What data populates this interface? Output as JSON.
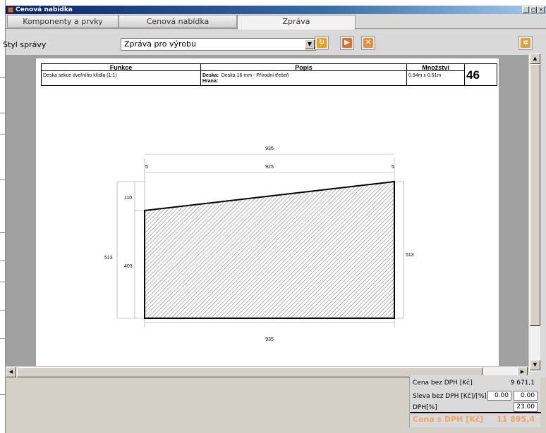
{
  "window": {
    "title": "Cenová nabídka",
    "controls": [
      "_",
      "□",
      "×"
    ]
  },
  "tabs": [
    {
      "label": "Komponenty a prvky",
      "active": false
    },
    {
      "label": "Cenová nabídka",
      "active": false
    },
    {
      "label": "Zpráva",
      "active": true
    }
  ],
  "toolbar": {
    "style_label": "Styl správy",
    "style_value": "Zpráva pro výrobu",
    "buttons": [
      "refresh-icon",
      "export-pdf-icon",
      "export-image-icon",
      "help-icon"
    ]
  },
  "report": {
    "headers": {
      "funkce": "Funkce",
      "popis": "Popis",
      "mnozstvi": "Množství"
    },
    "row": {
      "funkce": "Deska sekce dveřního křídla (1:1)",
      "deska_label": "Deska:",
      "deska_value": "Deska 16 mm - Přírodní třešeň",
      "hrana_label": "Hrana:",
      "mnozstvi": "0.94m x 0.51m",
      "count": "46"
    },
    "dimensions": {
      "top_total": "935",
      "top_left": "5",
      "top_middle": "925",
      "top_right": "5",
      "left_total": "513",
      "left_upper": "110",
      "left_lower": "403",
      "right_total": "513",
      "bottom_total": "935"
    }
  },
  "prices": {
    "cena_bez_dph_label": "Cena bez DPH [Kč]",
    "cena_bez_dph_value": "9 671,1",
    "sleva_label": "Sleva bez DPH [Kč]/[%]",
    "sleva_kc": "0.00",
    "sleva_pct": "0.00",
    "dph_label": "DPH[%]",
    "dph_value": "23.00",
    "cena_s_dph_label": "Cena s DPH [Kč]",
    "cena_s_dph_value": "11 895,4"
  },
  "colors": {
    "total_accent": "#f4a460",
    "title_bar": "#0a246a"
  }
}
